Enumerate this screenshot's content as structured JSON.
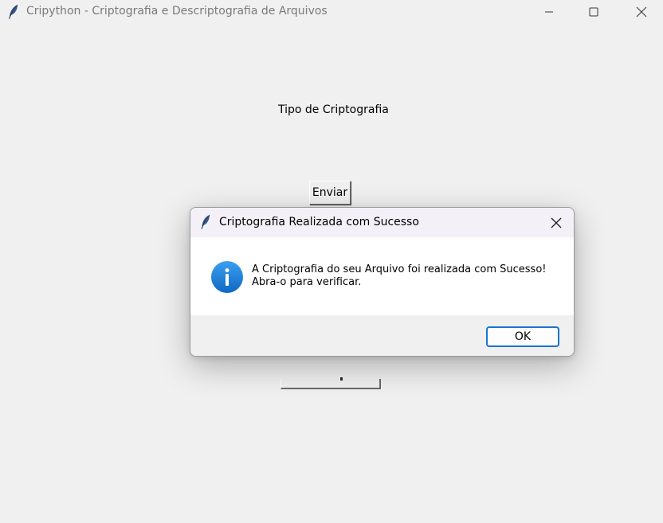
{
  "window": {
    "title": "Cripython - Criptografia e Descriptografia de Arquivos",
    "icon": "feather-icon",
    "controls": [
      "minimize-icon",
      "maximize-icon",
      "close-icon"
    ]
  },
  "main": {
    "label_tipo": "Tipo de Criptografia",
    "btn_enviar": "Enviar"
  },
  "dialog": {
    "title": "Criptografia Realizada com Sucesso",
    "icon": "info-icon",
    "message_line1": "A Criptografia do seu Arquivo foi realizada com Sucesso!",
    "message_line2": "Abra-o para verificar.",
    "ok_label": "OK"
  },
  "colors": {
    "background": "#f0f0f0",
    "dialog_body": "#ffffff",
    "dialog_titlebar": "#f3f0f7",
    "accent": "#1a73d0",
    "info_icon": "#1e7fd8"
  }
}
